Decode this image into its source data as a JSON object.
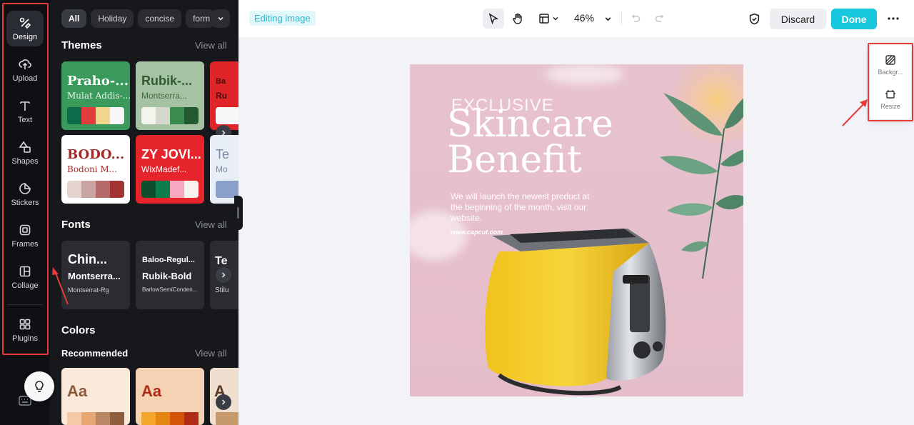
{
  "rail": {
    "items": [
      {
        "label": "Design",
        "icon": "design-icon",
        "active": true
      },
      {
        "label": "Upload",
        "icon": "upload-icon"
      },
      {
        "label": "Text",
        "icon": "text-icon"
      },
      {
        "label": "Shapes",
        "icon": "shapes-icon"
      },
      {
        "label": "Stickers",
        "icon": "stickers-icon"
      },
      {
        "label": "Frames",
        "icon": "frames-icon"
      },
      {
        "label": "Collage",
        "icon": "collage-icon"
      },
      {
        "label": "Plugins",
        "icon": "plugins-icon"
      }
    ]
  },
  "panel": {
    "chips": [
      "All",
      "Holiday",
      "concise",
      "form"
    ],
    "themes": {
      "title": "Themes",
      "view_all": "View all",
      "cards": [
        {
          "name": "Praho-...",
          "font": "Mulat Addis-...",
          "colors": [
            "#0e6b4a",
            "#e23c3c",
            "#f2d58d",
            "#f7f7f7"
          ]
        },
        {
          "name": "Rubik-...",
          "font": "Montserra...",
          "colors": [
            "#f4f4ef",
            "#d6d7cd",
            "#3b8a4e",
            "#245a32"
          ]
        },
        {
          "name": "Ba",
          "font": "Ru",
          "colors": [
            "#f7f7f7"
          ]
        },
        {
          "name": "BODO...",
          "font": "Bodoni M...",
          "colors": [
            "#e5d3cf",
            "#c9a4a1",
            "#b56a6a",
            "#a23434"
          ]
        },
        {
          "name": "ZY JOVI...",
          "font": "WixMadef...",
          "colors": [
            "#0f4d2d",
            "#0f7b4a",
            "#f5a8c0",
            "#f7f2ef"
          ]
        },
        {
          "name": "Te",
          "font": "Mo",
          "colors": [
            "#8aa0c8"
          ]
        }
      ]
    },
    "fonts": {
      "title": "Fonts",
      "view_all": "View all",
      "cards": [
        {
          "line1": "Chin...",
          "line2": "Montserra...",
          "line3": "Montserrat-Rg"
        },
        {
          "line1": "Baloo-Regul...",
          "line2": "Rubik-Bold",
          "line3": "BarlowSemiConden..."
        },
        {
          "line1": "Te",
          "line2": "",
          "line3": "Stilu"
        }
      ]
    },
    "colors": {
      "title": "Colors",
      "recommended": "Recommended",
      "view_all": "View all",
      "cards": [
        {
          "aa": "Aa",
          "bg": "#fbe9da",
          "fg": "#8a5a3a",
          "colors": [
            "#f5c9a8",
            "#e8a673",
            "#b98762",
            "#8f5e3e"
          ]
        },
        {
          "aa": "Aa",
          "bg": "#f6d2b4",
          "fg": "#b02a15",
          "colors": [
            "#f2a72c",
            "#e4860f",
            "#d35308",
            "#b02a15"
          ]
        },
        {
          "aa": "A",
          "bg": "#f0dfcf",
          "fg": "#5a3a22",
          "colors": [
            "#c79a6c"
          ]
        }
      ]
    }
  },
  "topbar": {
    "editing_label": "Editing image",
    "zoom": "46%",
    "discard": "Discard",
    "done": "Done"
  },
  "design": {
    "exclusive": "EXCLUSIVE",
    "line1": "Skincare",
    "line2": "Benefit",
    "body": "We will launch the newest product at the beginning of the month, visit our website.",
    "url": "www.capcut.com"
  },
  "float": {
    "background": "Backgr...",
    "resize": "Resize"
  }
}
